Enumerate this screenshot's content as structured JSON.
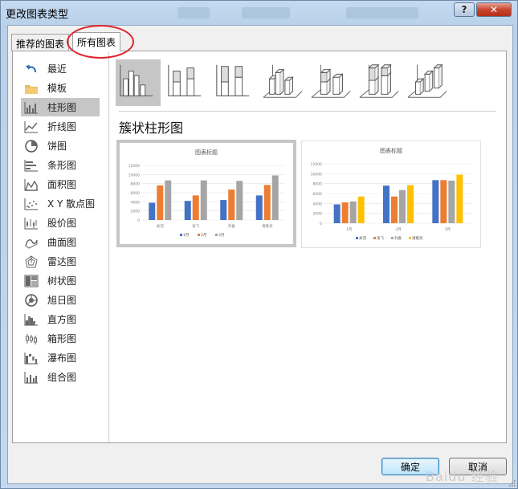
{
  "window": {
    "title": "更改图表类型",
    "help_label": "?",
    "close_label": "✕"
  },
  "tabs": [
    {
      "label": "推荐的图表"
    },
    {
      "label": "所有图表"
    }
  ],
  "sidebar": {
    "items": [
      {
        "label": "最近",
        "icon": "undo-arrow-icon"
      },
      {
        "label": "模板",
        "icon": "folder-icon"
      },
      {
        "label": "柱形图",
        "icon": "column-chart-icon",
        "selected": true
      },
      {
        "label": "折线图",
        "icon": "line-chart-icon"
      },
      {
        "label": "饼图",
        "icon": "pie-chart-icon"
      },
      {
        "label": "条形图",
        "icon": "bar-chart-icon"
      },
      {
        "label": "面积图",
        "icon": "area-chart-icon"
      },
      {
        "label": "X Y 散点图",
        "icon": "scatter-chart-icon"
      },
      {
        "label": "股价图",
        "icon": "stock-chart-icon"
      },
      {
        "label": "曲面图",
        "icon": "surface-chart-icon"
      },
      {
        "label": "雷达图",
        "icon": "radar-chart-icon"
      },
      {
        "label": "树状图",
        "icon": "treemap-chart-icon"
      },
      {
        "label": "旭日图",
        "icon": "sunburst-chart-icon"
      },
      {
        "label": "直方图",
        "icon": "histogram-chart-icon"
      },
      {
        "label": "箱形图",
        "icon": "box-whisker-chart-icon"
      },
      {
        "label": "瀑布图",
        "icon": "waterfall-chart-icon"
      },
      {
        "label": "组合图",
        "icon": "combo-chart-icon"
      }
    ]
  },
  "subtypes": [
    {
      "icon": "clustered-column-icon",
      "selected": true
    },
    {
      "icon": "stacked-column-icon"
    },
    {
      "icon": "100-stacked-column-icon"
    },
    {
      "icon": "3d-clustered-column-icon"
    },
    {
      "icon": "3d-stacked-column-icon"
    },
    {
      "icon": "3d-100-stacked-column-icon"
    },
    {
      "icon": "3d-column-icon"
    }
  ],
  "main": {
    "heading": "簇状柱形图"
  },
  "colors": {
    "blue": "#4472c4",
    "orange": "#ed7d31",
    "gray": "#a5a5a5",
    "yellow": "#ffc000"
  },
  "chart_data": [
    {
      "type": "bar",
      "title": "图表标题",
      "categories": [
        "关羽",
        "张飞",
        "刘备",
        "诸葛亮"
      ],
      "ylim": [
        0,
        12000
      ],
      "yticks": [
        0,
        2000,
        4000,
        6000,
        8000,
        10000,
        12000
      ],
      "series": [
        {
          "name": "1月",
          "values": [
            3800,
            4200,
            4400,
            5400
          ]
        },
        {
          "name": "2月",
          "values": [
            7600,
            5400,
            6700,
            7700
          ]
        },
        {
          "name": "3月",
          "values": [
            8700,
            8700,
            8600,
            9800
          ]
        }
      ],
      "legend": "bottom"
    },
    {
      "type": "bar",
      "title": "图表标题",
      "categories": [
        "1月",
        "2月",
        "3月"
      ],
      "ylim": [
        0,
        12000
      ],
      "yticks": [
        0,
        2000,
        4000,
        6000,
        8000,
        10000,
        12000
      ],
      "series": [
        {
          "name": "关羽",
          "values": [
            3800,
            7600,
            8700
          ]
        },
        {
          "name": "张飞",
          "values": [
            4200,
            5400,
            8700
          ]
        },
        {
          "name": "刘备",
          "values": [
            4400,
            6700,
            8600
          ]
        },
        {
          "name": "诸葛亮",
          "values": [
            5400,
            7700,
            9800
          ]
        }
      ],
      "legend": "bottom"
    }
  ],
  "footer": {
    "ok_label": "确定",
    "cancel_label": "取消"
  }
}
